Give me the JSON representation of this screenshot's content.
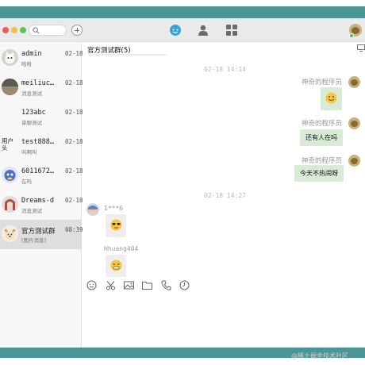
{
  "window": {
    "frame_color": "#4a9696",
    "traffic_lights": [
      "#f05b55",
      "#f4bf4f",
      "#5fc455"
    ]
  },
  "topnav": {
    "icons": [
      "chat-icon",
      "contacts-icon",
      "apps-grid-icon"
    ],
    "active_color": "#3aa3d8"
  },
  "conversations": [
    {
      "name": "admin",
      "time": "02-18",
      "preview": "哈哈"
    },
    {
      "name": "meiliuc…",
      "time": "02-18",
      "preview": "消息测试"
    },
    {
      "name": "123abc",
      "time": "02-18",
      "preview": "单聊测试"
    },
    {
      "name": "test888…",
      "time": "02-18",
      "preview": "叫啊叫",
      "avatar_alt": "用户头"
    },
    {
      "name": "6011672…",
      "time": "02-18",
      "preview": "在吗"
    },
    {
      "name": "Dreams-d",
      "time": "02-18",
      "preview": "消息测试"
    },
    {
      "name": "官方测试群",
      "time": "08:39",
      "preview": "[图片消息]"
    }
  ],
  "chat": {
    "title": "官方测试群(5)",
    "divider_1": "02-18 14:14",
    "divider_2": "02-18 14:27",
    "messages": [
      {
        "side": "right",
        "sender": "神奇的程序员",
        "type": "emoji"
      },
      {
        "side": "right",
        "sender": "神奇的程序员",
        "type": "text",
        "text": "还有人在吗"
      },
      {
        "side": "right",
        "sender": "神奇的程序员",
        "type": "text",
        "text": "今天不热闹呀"
      },
      {
        "side": "left",
        "sender": "1***6",
        "type": "emoji"
      },
      {
        "side": "left",
        "sender": "Hhuang404",
        "type": "emoji"
      }
    ]
  },
  "input_toolbar": [
    "emoji-icon",
    "scissors-icon",
    "image-icon",
    "folder-icon",
    "phone-icon",
    "history-icon"
  ],
  "watermark": "@稀土掘金技术社区"
}
